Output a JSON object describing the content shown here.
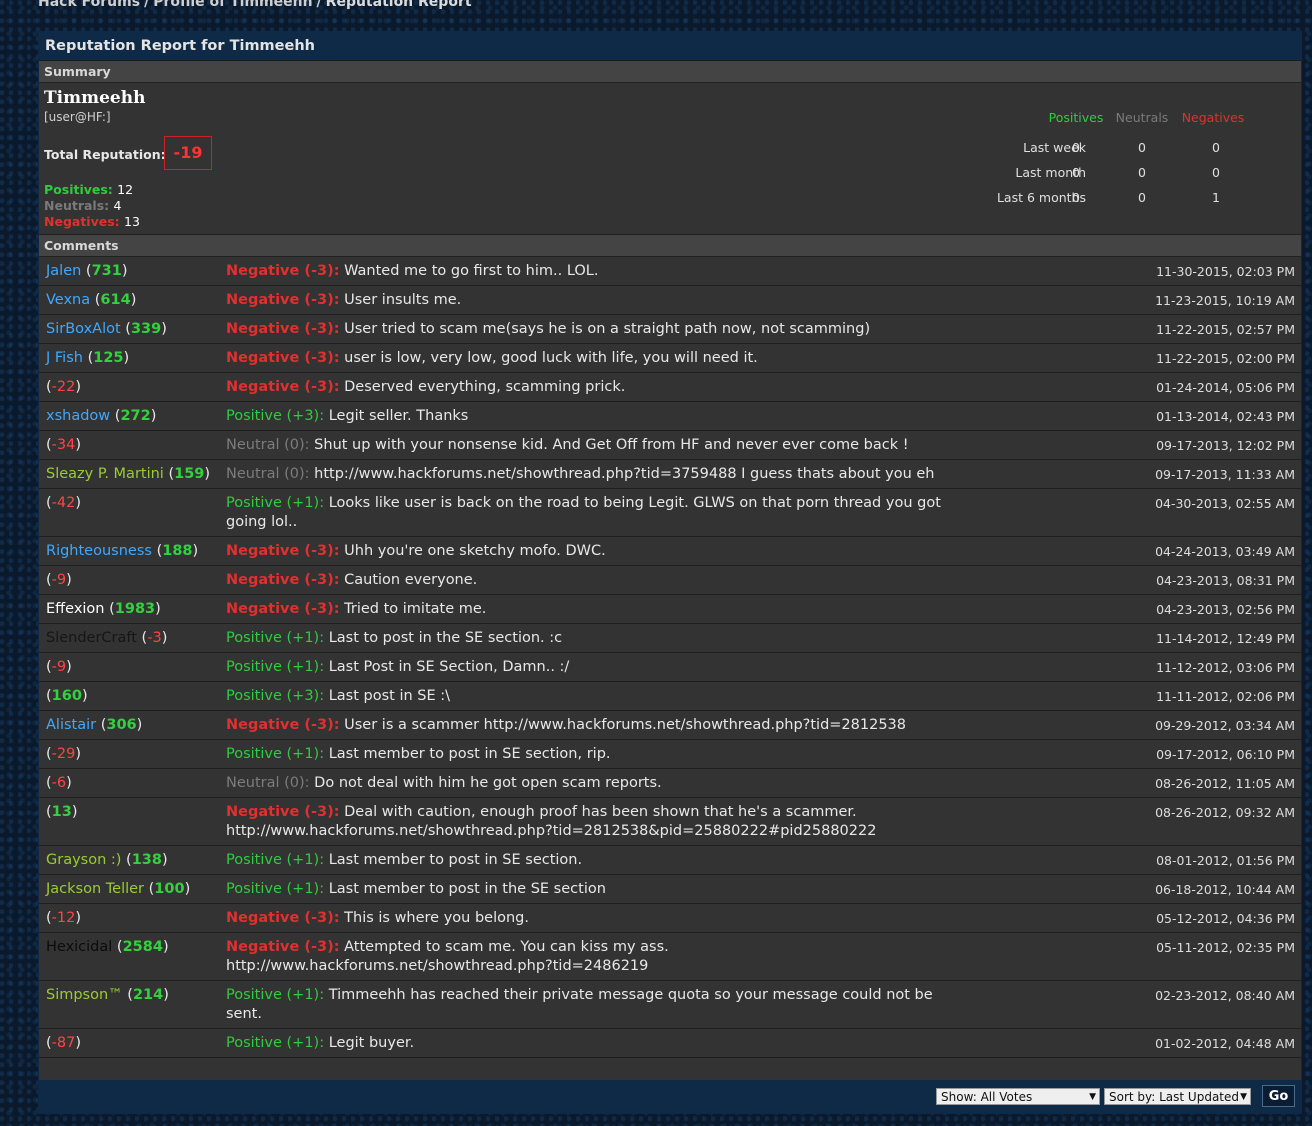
{
  "breadcrumb": [
    "Hack Forums",
    "Profile of Timmeehh",
    "Reputation Report"
  ],
  "thead_title": "Reputation Report for Timmeehh",
  "summary_label": "Summary",
  "comments_label": "Comments",
  "user": {
    "name": "Timmeehh",
    "title": "[user@HF:]"
  },
  "total_label": "Total Reputation:",
  "total_value": "-19",
  "counts": {
    "pos_label": "Positives:",
    "pos": "12",
    "neu_label": "Neutrals:",
    "neu": "4",
    "neg_label": "Negatives:",
    "neg": "13"
  },
  "stats": {
    "headers": [
      "Positives",
      "Neutrals",
      "Negatives"
    ],
    "rows": [
      {
        "label": "Last week",
        "values": [
          "0",
          "0",
          "0"
        ]
      },
      {
        "label": "Last month",
        "values": [
          "0",
          "0",
          "0"
        ]
      },
      {
        "label": "Last 6 months",
        "values": [
          "0",
          "0",
          "1"
        ]
      }
    ]
  },
  "comments": [
    {
      "user": "Jalen",
      "ucls": "u-blue",
      "rep": "731",
      "rcls": "rp-pos",
      "type": "neg",
      "label": "Negative (-3):",
      "text": "Wanted me to go first to him.. LOL.",
      "date": "11-30-2015, 02:03 PM"
    },
    {
      "user": "Vexna",
      "ucls": "u-blue",
      "rep": "614",
      "rcls": "rp-pos",
      "type": "neg",
      "label": "Negative (-3):",
      "text": "User insults me.",
      "date": "11-23-2015, 10:19 AM"
    },
    {
      "user": "SirBoxAlot",
      "ucls": "u-blue",
      "rep": "339",
      "rcls": "rp-pos",
      "type": "neg",
      "label": "Negative (-3):",
      "text": "User tried to scam me(says he is on a straight path now, not scamming)",
      "date": "11-22-2015, 02:57 PM"
    },
    {
      "user": "J Fish",
      "ucls": "u-blue",
      "rep": "125",
      "rcls": "rp-pos",
      "type": "neg",
      "label": "Negative (-3):",
      "text": "user is low, very low, good luck with life, you will need it.",
      "date": "11-22-2015, 02:00 PM"
    },
    {
      "user": "",
      "ucls": "u-dark",
      "rep": "-22",
      "rcls": "rp-neg",
      "type": "neg",
      "label": "Negative (-3):",
      "text": "Deserved everything, scamming prick.",
      "date": "01-24-2014, 05:06 PM"
    },
    {
      "user": "xshadow",
      "ucls": "u-blue",
      "rep": "272",
      "rcls": "rp-pos",
      "type": "pos",
      "label": "Positive (+3):",
      "text": "Legit seller. Thanks",
      "date": "01-13-2014, 02:43 PM"
    },
    {
      "user": "",
      "ucls": "u-dark",
      "rep": "-34",
      "rcls": "rp-neg",
      "type": "neu",
      "label": "Neutral (0):",
      "text": "Shut up with your nonsense kid. And Get Off from HF and never ever come back !",
      "date": "09-17-2013, 12:02 PM"
    },
    {
      "user": "Sleazy P. Martini",
      "ucls": "u-green",
      "rep": "159",
      "rcls": "rp-pos",
      "type": "neu",
      "label": "Neutral (0):",
      "text": "http://www.hackforums.net/showthread.php?tid=3759488 I guess thats about you eh",
      "date": "09-17-2013, 11:33 AM"
    },
    {
      "user": "",
      "ucls": "u-dark",
      "rep": "-42",
      "rcls": "rp-neg",
      "type": "pos",
      "label": "Positive (+1):",
      "text": "Looks like user is back on the road to being Legit. GLWS on that porn thread you got going lol..",
      "date": "04-30-2013, 02:55 AM"
    },
    {
      "user": "Righteousness",
      "ucls": "u-blue",
      "rep": "188",
      "rcls": "rp-pos",
      "type": "neg",
      "label": "Negative (-3):",
      "text": "Uhh you're one sketchy mofo. DWC.",
      "date": "04-24-2013, 03:49 AM"
    },
    {
      "user": "",
      "ucls": "u-dark",
      "rep": "-9",
      "rcls": "rp-neg",
      "type": "neg",
      "label": "Negative (-3):",
      "text": "Caution everyone.",
      "date": "04-23-2013, 08:31 PM"
    },
    {
      "user": "Effexion",
      "ucls": "u-white",
      "rep": "1983",
      "rcls": "rp-pos",
      "type": "neg",
      "label": "Negative (-3):",
      "text": "Tried to imitate me.",
      "date": "04-23-2013, 02:56 PM"
    },
    {
      "user": "SlenderCraft",
      "ucls": "u-blk2",
      "rep": "-3",
      "rcls": "rp-neg",
      "type": "pos",
      "label": "Positive (+1):",
      "text": "Last to post in the SE section. :c",
      "date": "11-14-2012, 12:49 PM"
    },
    {
      "user": "",
      "ucls": "u-dark",
      "rep": "-9",
      "rcls": "rp-neg",
      "type": "pos",
      "label": "Positive (+1):",
      "text": "Last Post in SE Section, Damn.. :/",
      "date": "11-12-2012, 03:06 PM"
    },
    {
      "user": "",
      "ucls": "u-dark",
      "rep": "160",
      "rcls": "rp-pos",
      "type": "pos",
      "label": "Positive (+3):",
      "text": "Last post in SE :\\",
      "date": "11-11-2012, 02:06 PM"
    },
    {
      "user": "Alistair",
      "ucls": "u-blue",
      "rep": "306",
      "rcls": "rp-pos",
      "type": "neg",
      "label": "Negative (-3):",
      "text": "User is a scammer http://www.hackforums.net/showthread.php?tid=2812538",
      "date": "09-29-2012, 03:34 AM"
    },
    {
      "user": "",
      "ucls": "u-dark",
      "rep": "-29",
      "rcls": "rp-neg",
      "type": "pos",
      "label": "Positive (+1):",
      "text": "Last member to post in SE section, rip.",
      "date": "09-17-2012, 06:10 PM"
    },
    {
      "user": "",
      "ucls": "u-dark",
      "rep": "-6",
      "rcls": "rp-neg",
      "type": "neu",
      "label": "Neutral (0):",
      "text": "Do not deal with him he got open scam reports.",
      "date": "08-26-2012, 11:05 AM"
    },
    {
      "user": "",
      "ucls": "u-dark",
      "rep": "13",
      "rcls": "rp-pos",
      "type": "neg",
      "label": "Negative (-3):",
      "text": "Deal with caution, enough proof has been shown that he's a scammer. http://www.hackforums.net/showthread.php?tid=2812538&pid=25880222#pid25880222",
      "date": "08-26-2012, 09:32 AM"
    },
    {
      "user": "Grayson :)",
      "ucls": "u-green",
      "rep": "138",
      "rcls": "rp-pos",
      "type": "pos",
      "label": "Positive (+1):",
      "text": "Last member to post in SE section.",
      "date": "08-01-2012, 01:56 PM"
    },
    {
      "user": "Jackson Teller",
      "ucls": "u-green",
      "rep": "100",
      "rcls": "rp-pos",
      "type": "pos",
      "label": "Positive (+1):",
      "text": "Last member to post in the SE section",
      "date": "06-18-2012, 10:44 AM"
    },
    {
      "user": "",
      "ucls": "u-dark",
      "rep": "-12",
      "rcls": "rp-neg",
      "type": "neg",
      "label": "Negative (-3):",
      "text": "This is where you belong.",
      "date": "05-12-2012, 04:36 PM"
    },
    {
      "user": "Hexicidal",
      "ucls": "u-black",
      "rep": "2584",
      "rcls": "rp-pos",
      "type": "neg",
      "label": "Negative (-3):",
      "text": "Attempted to scam me. You can kiss my ass. http://www.hackforums.net/showthread.php?tid=2486219",
      "date": "05-11-2012, 02:35 PM"
    },
    {
      "user": "Simpson™",
      "ucls": "u-green",
      "rep": "214",
      "rcls": "rp-pos",
      "type": "pos",
      "label": "Positive (+1):",
      "text": "Timmeehh has reached their private message quota so your message could not be sent.",
      "date": "02-23-2012, 08:40 AM"
    },
    {
      "user": "",
      "ucls": "u-dark",
      "rep": "-87",
      "rcls": "rp-neg",
      "type": "pos",
      "label": "Positive (+1):",
      "text": "Legit buyer.",
      "date": "01-02-2012, 04:48 AM"
    }
  ],
  "footer": {
    "show": "Show: All Votes",
    "sort": "Sort by: Last Updated",
    "go": "Go"
  }
}
